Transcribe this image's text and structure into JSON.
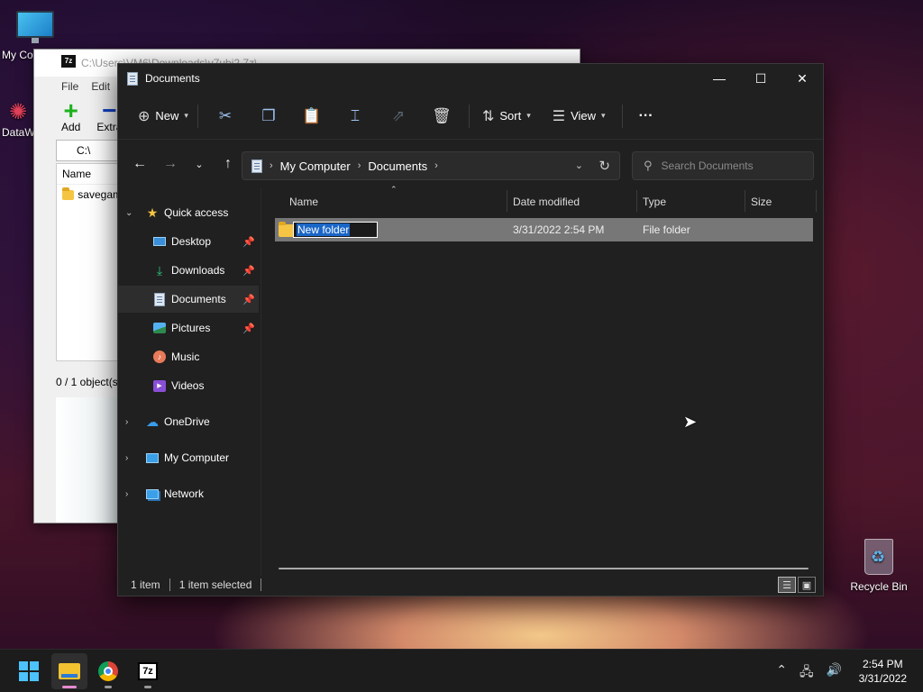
{
  "desktop": {
    "icons": [
      {
        "label": "My Co",
        "icon": "monitor-icon"
      },
      {
        "label": "DataW",
        "icon": "datawarrior-icon"
      },
      {
        "label": "Recycle Bin",
        "icon": "recycle-bin-icon"
      }
    ]
  },
  "sevenzip_window": {
    "title": "C:\\Users\\VM6\\Downloads\\v7ubi2.7z\\",
    "menu": [
      "File",
      "Edit"
    ],
    "toolbar": [
      "Add",
      "Extra"
    ],
    "path": "C:\\",
    "list_header": "Name",
    "list_items": [
      "savegam"
    ],
    "status": "0 / 1 object(s"
  },
  "explorer": {
    "title": "Documents",
    "window_buttons": {
      "minimize": "—",
      "maximize": "☐",
      "close": "✕"
    },
    "command_bar": {
      "new_label": "New",
      "sort_label": "Sort",
      "view_label": "View",
      "more_label": "···"
    },
    "address": {
      "segments": [
        "My Computer",
        "Documents"
      ]
    },
    "search_placeholder": "Search Documents",
    "nav": {
      "quick_access": "Quick access",
      "items": [
        {
          "label": "Desktop",
          "pinned": true
        },
        {
          "label": "Downloads",
          "pinned": true
        },
        {
          "label": "Documents",
          "pinned": true,
          "selected": true
        },
        {
          "label": "Pictures",
          "pinned": true
        },
        {
          "label": "Music",
          "pinned": false
        },
        {
          "label": "Videos",
          "pinned": false
        }
      ],
      "onedrive": "OneDrive",
      "my_computer": "My Computer",
      "network": "Network"
    },
    "columns": [
      "Name",
      "Date modified",
      "Type",
      "Size"
    ],
    "rows": [
      {
        "name": "New folder",
        "date_modified": "3/31/2022 2:54 PM",
        "type": "File folder",
        "size": ""
      }
    ],
    "status": {
      "item_count": "1 item",
      "selected": "1 item selected"
    }
  },
  "taskbar": {
    "apps": [
      "start-icon",
      "file-explorer-icon",
      "chrome-icon",
      "7zip-icon"
    ],
    "clock": {
      "time": "2:54 PM",
      "date": "3/31/2022"
    }
  },
  "colors": {
    "explorer_bg": "#202020",
    "selection_row": "#777777",
    "rename_highlight": "#1a66c7",
    "accent": "#4cc2ff"
  }
}
